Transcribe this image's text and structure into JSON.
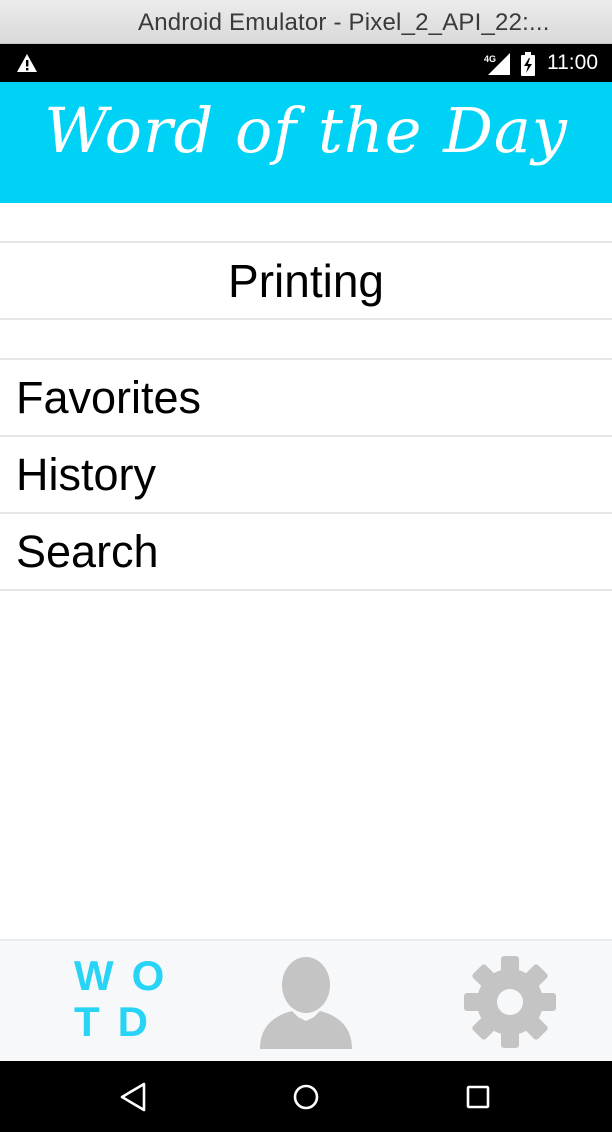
{
  "window": {
    "title": "Android Emulator - Pixel_2_API_22:..."
  },
  "status_bar": {
    "time": "11:00",
    "network": "4G",
    "icons": [
      "alert-icon",
      "signal-icon",
      "battery-charging-icon"
    ]
  },
  "header": {
    "title": "Word of the Day",
    "background": "#00d2f5"
  },
  "word": {
    "text": "Printing"
  },
  "menu": {
    "items": [
      {
        "label": "Favorites"
      },
      {
        "label": "History"
      },
      {
        "label": "Search"
      }
    ]
  },
  "tab_bar": {
    "tabs": [
      {
        "name": "wotd",
        "logo_line1": "WO",
        "logo_line2": "TD",
        "color": "#27d4f5"
      },
      {
        "name": "profile",
        "icon": "person-icon",
        "color": "#c4c4c4"
      },
      {
        "name": "settings",
        "icon": "gear-icon",
        "color": "#c4c4c4"
      }
    ]
  },
  "nav_bar": {
    "buttons": [
      "back-icon",
      "home-icon",
      "recents-icon"
    ]
  }
}
